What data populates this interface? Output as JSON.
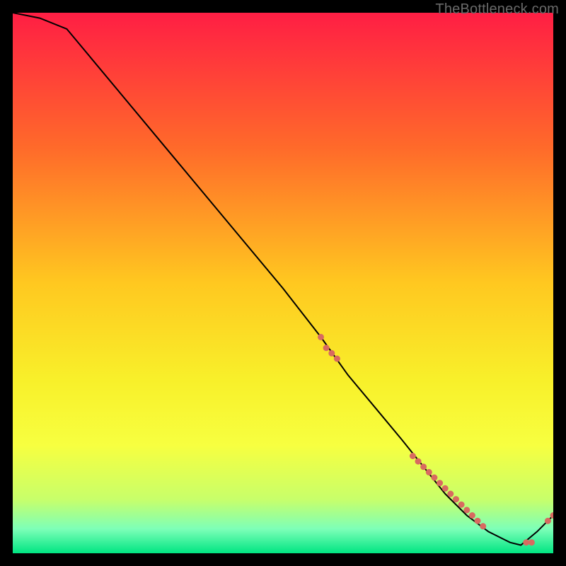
{
  "watermark": "TheBottleneck.com",
  "chart_data": {
    "type": "line",
    "title": "",
    "xlabel": "",
    "ylabel": "",
    "xlim": [
      0,
      100
    ],
    "ylim": [
      0,
      100
    ],
    "x": [
      0,
      5,
      10,
      20,
      30,
      40,
      50,
      57,
      62,
      67,
      72,
      76,
      80,
      84,
      88,
      92,
      94,
      97,
      100
    ],
    "values": [
      100,
      99,
      97,
      85,
      73,
      61,
      49,
      40,
      33,
      27,
      21,
      16,
      11,
      7,
      4,
      2,
      1.5,
      4,
      7
    ],
    "marker_points": {
      "x": [
        57,
        58,
        59,
        60,
        74,
        75,
        76,
        77,
        78,
        79,
        80,
        81,
        82,
        83,
        84,
        85,
        86,
        87,
        95,
        96,
        99,
        100
      ],
      "values": [
        40,
        38,
        37,
        36,
        18,
        17,
        16,
        15,
        14,
        13,
        12,
        11,
        10,
        9,
        8,
        7,
        6,
        5,
        2,
        2,
        6,
        7
      ]
    },
    "gradient_stops": [
      {
        "offset": 0.0,
        "color": "#ff1e44"
      },
      {
        "offset": 0.25,
        "color": "#ff6a2a"
      },
      {
        "offset": 0.5,
        "color": "#ffc820"
      },
      {
        "offset": 0.68,
        "color": "#f8f02a"
      },
      {
        "offset": 0.8,
        "color": "#f7ff40"
      },
      {
        "offset": 0.9,
        "color": "#c8ff6a"
      },
      {
        "offset": 0.955,
        "color": "#7dffb8"
      },
      {
        "offset": 1.0,
        "color": "#00e582"
      }
    ],
    "line_color": "#000000",
    "marker_color": "#d86a60",
    "background_frame": "#000000"
  }
}
